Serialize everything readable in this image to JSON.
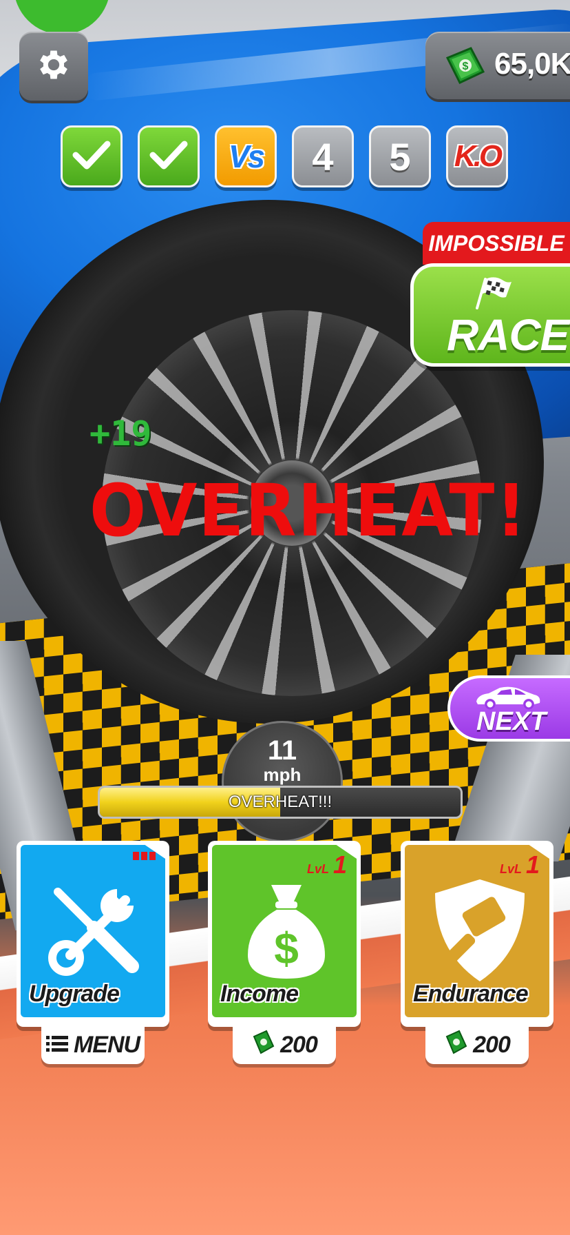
{
  "hud": {
    "cash": "65,0K"
  },
  "progress_steps": [
    {
      "type": "done",
      "label": ""
    },
    {
      "type": "done",
      "label": ""
    },
    {
      "type": "vs",
      "label": "Vs"
    },
    {
      "type": "num",
      "label": "4"
    },
    {
      "type": "num",
      "label": "5"
    },
    {
      "type": "ko",
      "label": "K.O"
    }
  ],
  "race": {
    "difficulty": "IMPOSSIBLE",
    "label": "RACE"
  },
  "effects": {
    "gain": "+19",
    "status": "OVERHEAT!"
  },
  "next": {
    "label": "NEXT"
  },
  "speed": {
    "value": "11",
    "unit": "mph"
  },
  "heat_bar": {
    "label": "OVERHEAT!!!",
    "fill_fraction": 0.5
  },
  "cards": {
    "upgrade": {
      "label": "Upgrade",
      "button": "MENU"
    },
    "income": {
      "label": "Income",
      "level_word": "LvL",
      "level": "1",
      "cost": "200"
    },
    "endurance": {
      "label": "Endurance",
      "level_word": "LvL",
      "level": "1",
      "cost": "200"
    }
  },
  "colors": {
    "upgrade_card": "#12a9f0",
    "income_card": "#5fc42a",
    "endurance_card": "#d9a22a",
    "accent_red": "#e3191d",
    "overheat_red": "#ee0d0d"
  },
  "icons": [
    "gear-icon",
    "cash-icon",
    "checkmark-icon",
    "checkered-flag-icon",
    "car-icon",
    "wrench-screwdriver-icon",
    "money-bag-icon",
    "shield-hammer-icon",
    "menu-list-icon"
  ]
}
